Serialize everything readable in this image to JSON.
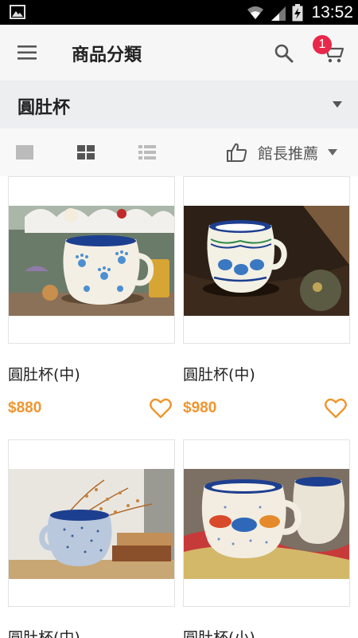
{
  "status_bar": {
    "time": "13:52"
  },
  "app_bar": {
    "title": "商品分類",
    "cart_count": "1"
  },
  "category": {
    "selected": "圓肚杯"
  },
  "sort": {
    "label": "館長推薦"
  },
  "colors": {
    "accent": "#f0952e",
    "badge": "#e8284a",
    "cobalt": "#1d3f8f"
  },
  "products": [
    {
      "name": "圓肚杯(中)",
      "price": "$880",
      "pattern": "blue-paw-prints"
    },
    {
      "name": "圓肚杯(中)",
      "price": "$980",
      "pattern": "blue-teapot-border"
    },
    {
      "name": "圓肚杯(中)",
      "price": "",
      "pattern": "blue-speckle"
    },
    {
      "name": "圓肚杯(小)",
      "price": "",
      "pattern": "red-blue-cats"
    }
  ]
}
